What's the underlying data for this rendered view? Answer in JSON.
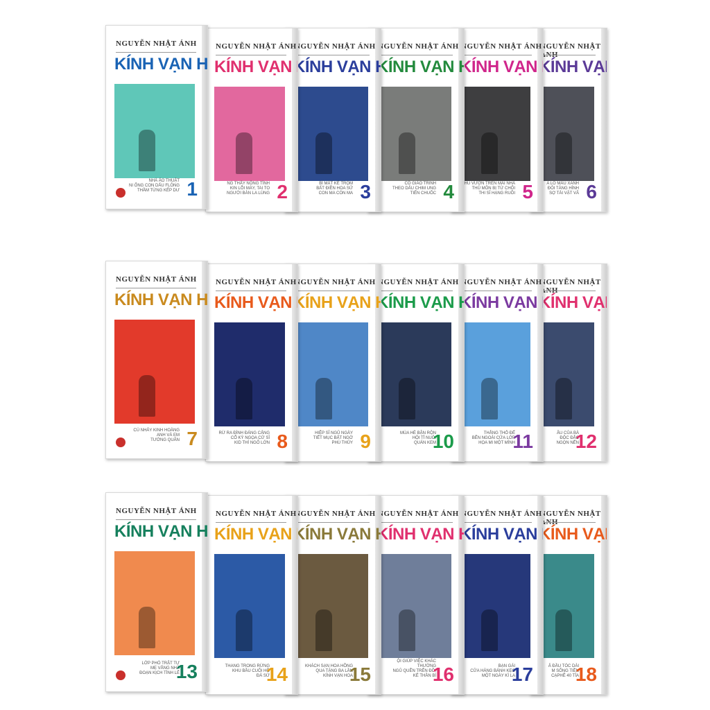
{
  "author": "NGUYỄN NHẬT ÁNH",
  "series_title": "KÍNH VẠN HOA",
  "books": [
    {
      "num": "1",
      "color": "#1a63b4",
      "art": "#5fc7b8",
      "caption": "NHÀ ẢO THUẬT\nNI ỐNG CON DẤU FLÔNG\nTHẦM TỪNG KẾP DƯ",
      "icon": "magician-figure-icon"
    },
    {
      "num": "2",
      "color": "#e0306e",
      "art": "#e2689e",
      "caption": "NG THẤY NÔNG TÌNH\nKIN LỖI MÀY, TAI TO\nNGƯỜI BÀN LA LÙNG",
      "icon": "people-group-icon"
    },
    {
      "num": "3",
      "color": "#2b3e9c",
      "art": "#2d4b8e",
      "caption": "BÍ MẬT KẺ TRỘM\nBẤT ĐIỀN HOA SỬ\nCON MA CÓN MA",
      "icon": "night-moon-icon"
    },
    {
      "num": "4",
      "color": "#238a3d",
      "art": "#7a7c7a",
      "caption": "CÔ GIÁO TRINH\nTHEO DẤU CHIM UNG\nTIẾN CHUỐC",
      "icon": "boys-standing-icon"
    },
    {
      "num": "5",
      "color": "#d0268b",
      "art": "#3e3e40",
      "caption": "KHU VƯỜN TRÊN MÁI NHÀ\nTHỦ MÔN BỊ TỪ CHỐI\nTHI SĨ HẠNG RUỒI",
      "icon": "child-sitting-icon"
    },
    {
      "num": "6",
      "color": "#5b3a97",
      "art": "#4e5058",
      "caption": "A LÔ MÀU XANH\nĐÔI TÀNG HÌNH\nSỢ TÀI VẶT VÃ",
      "icon": "dark-scene-icon"
    },
    {
      "num": "7",
      "color": "#c98a1e",
      "art": "#e23a2b",
      "caption": "CÚ NHẢY KINH HOÀNG\nANH VÀ EM\nTƯỚNG QUÂN",
      "icon": "general-warrior-icon"
    },
    {
      "num": "8",
      "color": "#e85a1c",
      "art": "#1f2c6b",
      "caption": "RỪ RA ĐÌNH ĐÁNG CẢNG\nCỔ KỲ NGỌA CỬ SĨ\nKID THÍ NGỐ LỚN",
      "icon": "crowd-icon"
    },
    {
      "num": "9",
      "color": "#e8a21a",
      "art": "#4f87c7",
      "caption": "HIỆP SĨ NGỦ NGÀY\nTIẾT MỤC BẤT NGỜ\nPHÙ THỦY",
      "icon": "boy-on-hill-icon"
    },
    {
      "num": "10",
      "color": "#1b9b4a",
      "art": "#2b3a5a",
      "caption": "MÙA HÈ BẬN RỘN\nHỘI TỈ NUÔI\nQUÁN KEM",
      "icon": "sparkler-child-icon"
    },
    {
      "num": "11",
      "color": "#7b3aa0",
      "art": "#5aa0dc",
      "caption": "THẰNG THỎ ĐẾ\nBÊN NGOÀI CỬA LỚP\nHỌA MI MỘT MÌNH",
      "icon": "bicycle-riders-icon"
    },
    {
      "num": "12",
      "color": "#e0306e",
      "art": "#3b4b6e",
      "caption": "ÂU CỦA BÀ\nĐỘC ĐẮC\nNGỌN NẾN",
      "icon": "stilt-house-icon"
    },
    {
      "num": "13",
      "color": "#16805d",
      "art": "#f08a4e",
      "caption": "LỚP PHÓ TRẬT TỰ\nMẸ VẮNG NHÀ\nĐOẠN KỊCH TÌNH LẺ",
      "icon": "ladder-man-icon"
    },
    {
      "num": "14",
      "color": "#e8a21a",
      "art": "#2c5aa6",
      "caption": "THANG TRONG RỪNG\nKHU BẦU CUỐI HỒ\nĐÀ SỬ",
      "icon": "fisher-boy-icon"
    },
    {
      "num": "15",
      "color": "#8a7a3a",
      "art": "#6b5a40",
      "caption": "KHÁCH SẠN HOA HỒNG\nQUA TẶNG BA LẦN\nKÍNH VẠN HOA",
      "icon": "doorway-man-icon"
    },
    {
      "num": "16",
      "color": "#e0306e",
      "art": "#6f7e9a",
      "caption": "ỘI GIÚP VIỆC KHÁC THƯỜNG\nNGỦ QUÊN TRÊN ĐỒI\nKẺ THẦN BÍ",
      "icon": "wave-rider-icon"
    },
    {
      "num": "17",
      "color": "#2b3e9c",
      "art": "#26387a",
      "caption": "BẠN GÁI\nCỬA HÀNG BÁNH KẸO\nMỘT NGÀY KÌ LẠ",
      "icon": "window-lamp-icon"
    },
    {
      "num": "18",
      "color": "#e85a1c",
      "art": "#3a8a8a",
      "caption": "Ả ĐẦU TÓC DÀI\nM SỐNG TIỀN\nCẠPHÊ 40 TỈA",
      "icon": "girl-sitting-icon"
    }
  ]
}
